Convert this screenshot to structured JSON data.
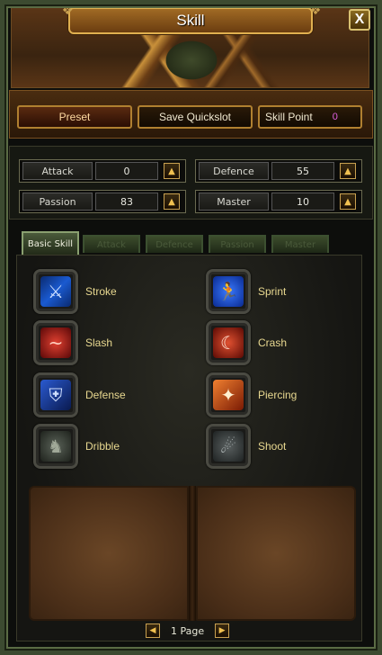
{
  "window": {
    "title": "Skill",
    "close_label": "X"
  },
  "toolbar": {
    "preset": "Preset",
    "save_quickslot": "Save Quickslot",
    "skill_point_label": "Skill Point",
    "skill_point_value": "0"
  },
  "stats": [
    {
      "label": "Attack",
      "value": "0"
    },
    {
      "label": "Defence",
      "value": "55"
    },
    {
      "label": "Passion",
      "value": "83"
    },
    {
      "label": "Master",
      "value": "10"
    }
  ],
  "tabs": [
    "Basic Skill",
    "Attack",
    "Defence",
    "Passion",
    "Master"
  ],
  "skills": [
    {
      "name": "Stroke",
      "icon": "sword-icon",
      "color": "#1a5ad0"
    },
    {
      "name": "Sprint",
      "icon": "running-figure-icon",
      "color": "#1a4ae0"
    },
    {
      "name": "Slash",
      "icon": "red-swirl-icon",
      "color": "#b01818"
    },
    {
      "name": "Crash",
      "icon": "red-crescent-icon",
      "color": "#b02010"
    },
    {
      "name": "Defense",
      "icon": "blue-shield-icon",
      "color": "#1a3aa0"
    },
    {
      "name": "Piercing",
      "icon": "orange-burst-icon",
      "color": "#c03a08"
    },
    {
      "name": "Dribble",
      "icon": "gray-figure-icon",
      "color": "#40483a"
    },
    {
      "name": "Shoot",
      "icon": "gray-comet-icon",
      "color": "#3a4040"
    }
  ],
  "pager": {
    "label": "1 Page"
  }
}
